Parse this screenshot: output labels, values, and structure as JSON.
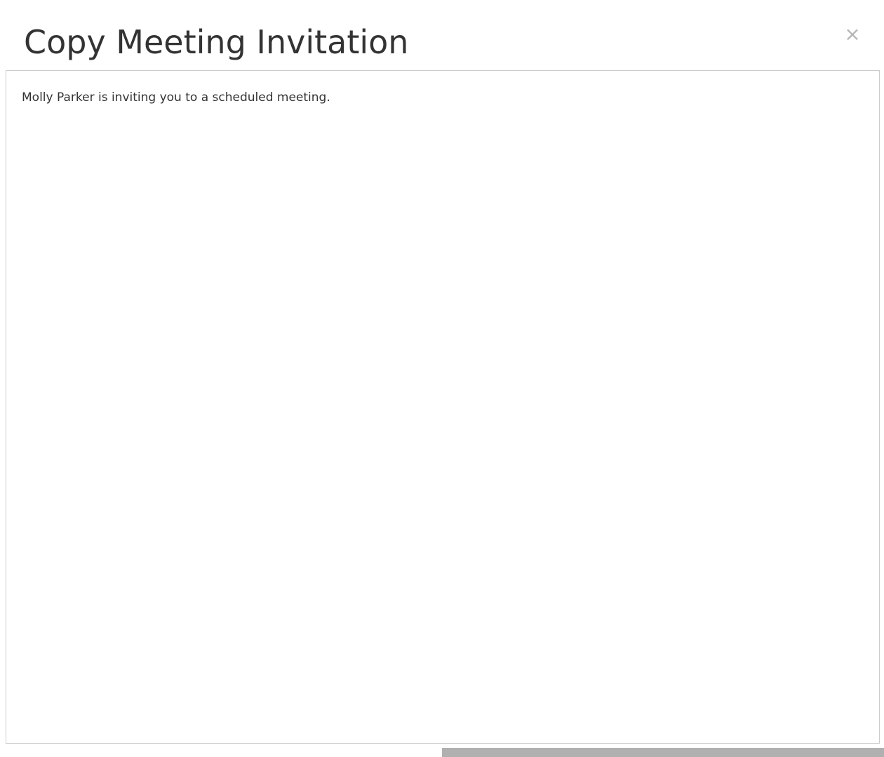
{
  "dialog": {
    "title": "Copy Meeting Invitation",
    "close_glyph": "×",
    "close_icon": "close-icon"
  },
  "invitation": {
    "text": "Molly Parker is inviting you to a scheduled meeting."
  }
}
